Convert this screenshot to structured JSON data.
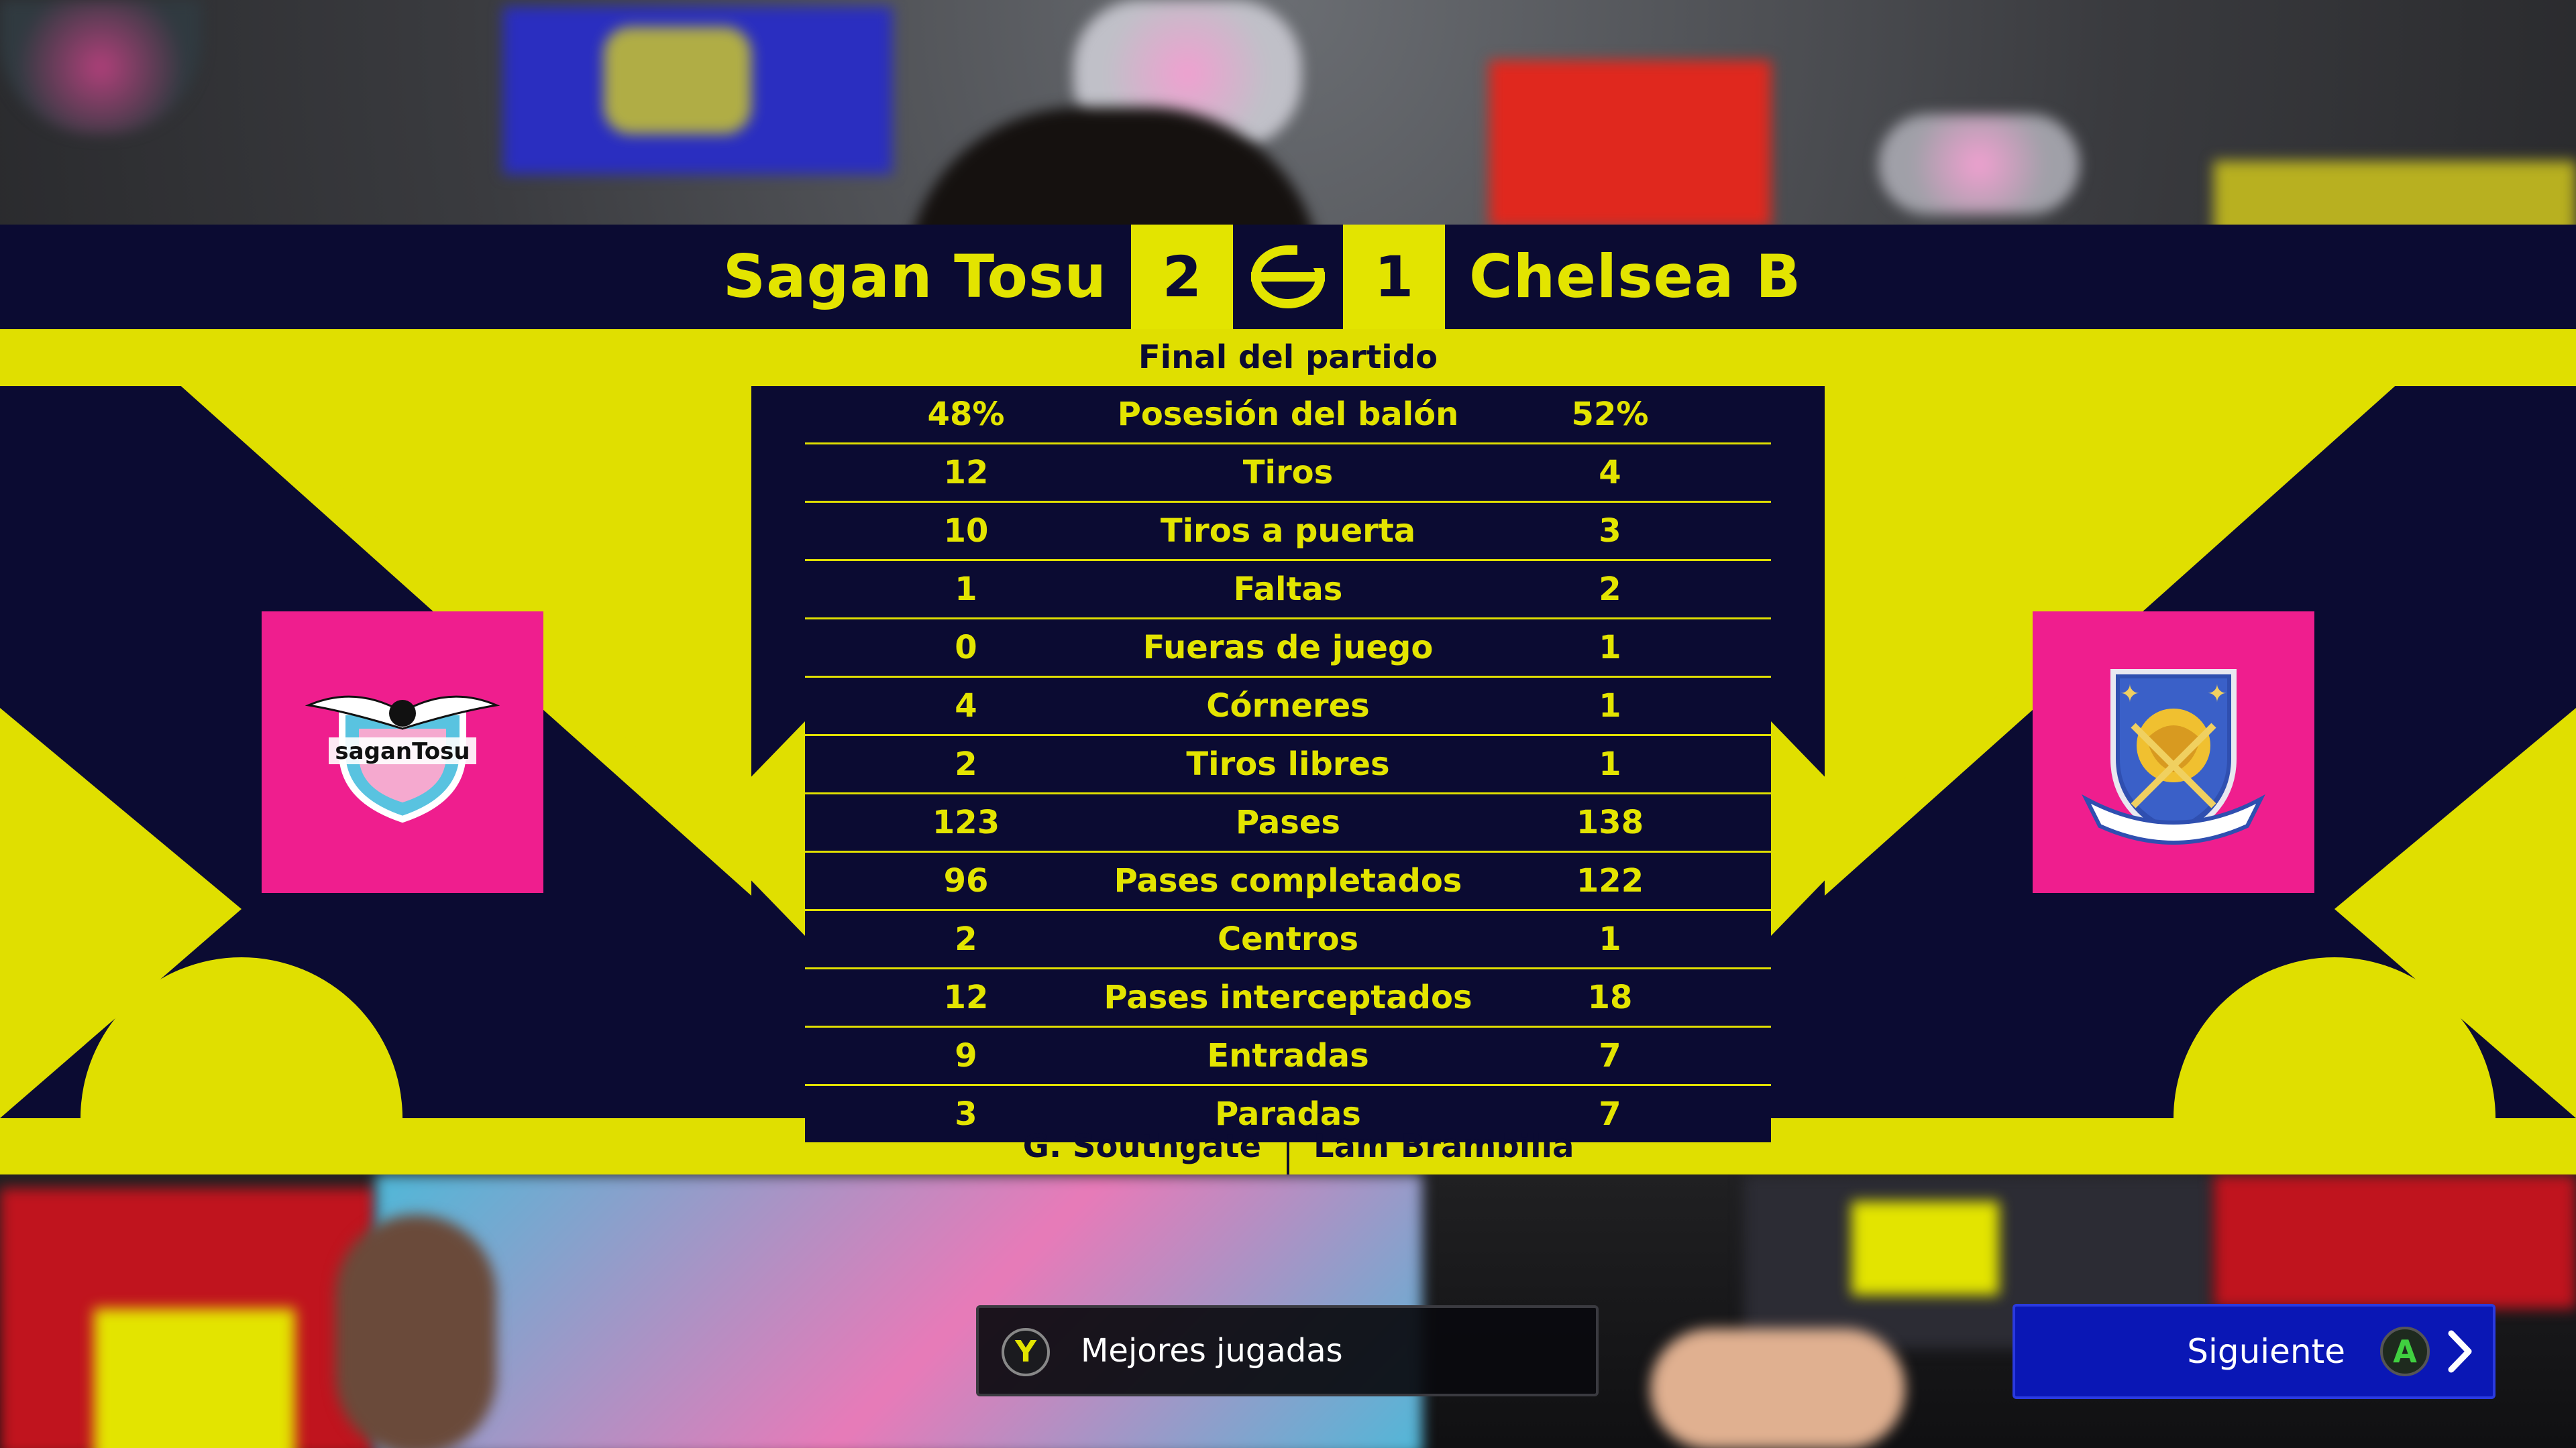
{
  "match": {
    "home_team": "Sagan Tosu",
    "away_team": "Chelsea B",
    "home_score": "2",
    "away_score": "1",
    "status": "Final del partido"
  },
  "stats": [
    {
      "label": "Posesión del balón",
      "home": "48%",
      "away": "52%"
    },
    {
      "label": "Tiros",
      "home": "12",
      "away": "4"
    },
    {
      "label": "Tiros a puerta",
      "home": "10",
      "away": "3"
    },
    {
      "label": "Faltas",
      "home": "1",
      "away": "2"
    },
    {
      "label": "Fueras de juego",
      "home": "0",
      "away": "1"
    },
    {
      "label": "Córneres",
      "home": "4",
      "away": "1"
    },
    {
      "label": "Tiros libres",
      "home": "2",
      "away": "1"
    },
    {
      "label": "Pases",
      "home": "123",
      "away": "138"
    },
    {
      "label": "Pases completados",
      "home": "96",
      "away": "122"
    },
    {
      "label": "Centros",
      "home": "2",
      "away": "1"
    },
    {
      "label": "Pases interceptados",
      "home": "12",
      "away": "18"
    },
    {
      "label": "Entradas",
      "home": "9",
      "away": "7"
    },
    {
      "label": "Paradas",
      "home": "3",
      "away": "7"
    }
  ],
  "managers": {
    "home": "G. Southgate",
    "away": "Lam Brambilla"
  },
  "crests": {
    "home_text": "saganTosu"
  },
  "buttons": {
    "highlights_label": "Mejores jugadas",
    "highlights_key": "Y",
    "next_label": "Siguiente",
    "next_key": "A"
  },
  "colors": {
    "navy": "#0b0b32",
    "yellow": "#e0df00",
    "crest_pink": "#ef1e8e",
    "next_button_blue": "#0a17b5"
  },
  "icons": {
    "game_logo": "efootball-logo-icon",
    "next": "chevron-right-icon"
  }
}
